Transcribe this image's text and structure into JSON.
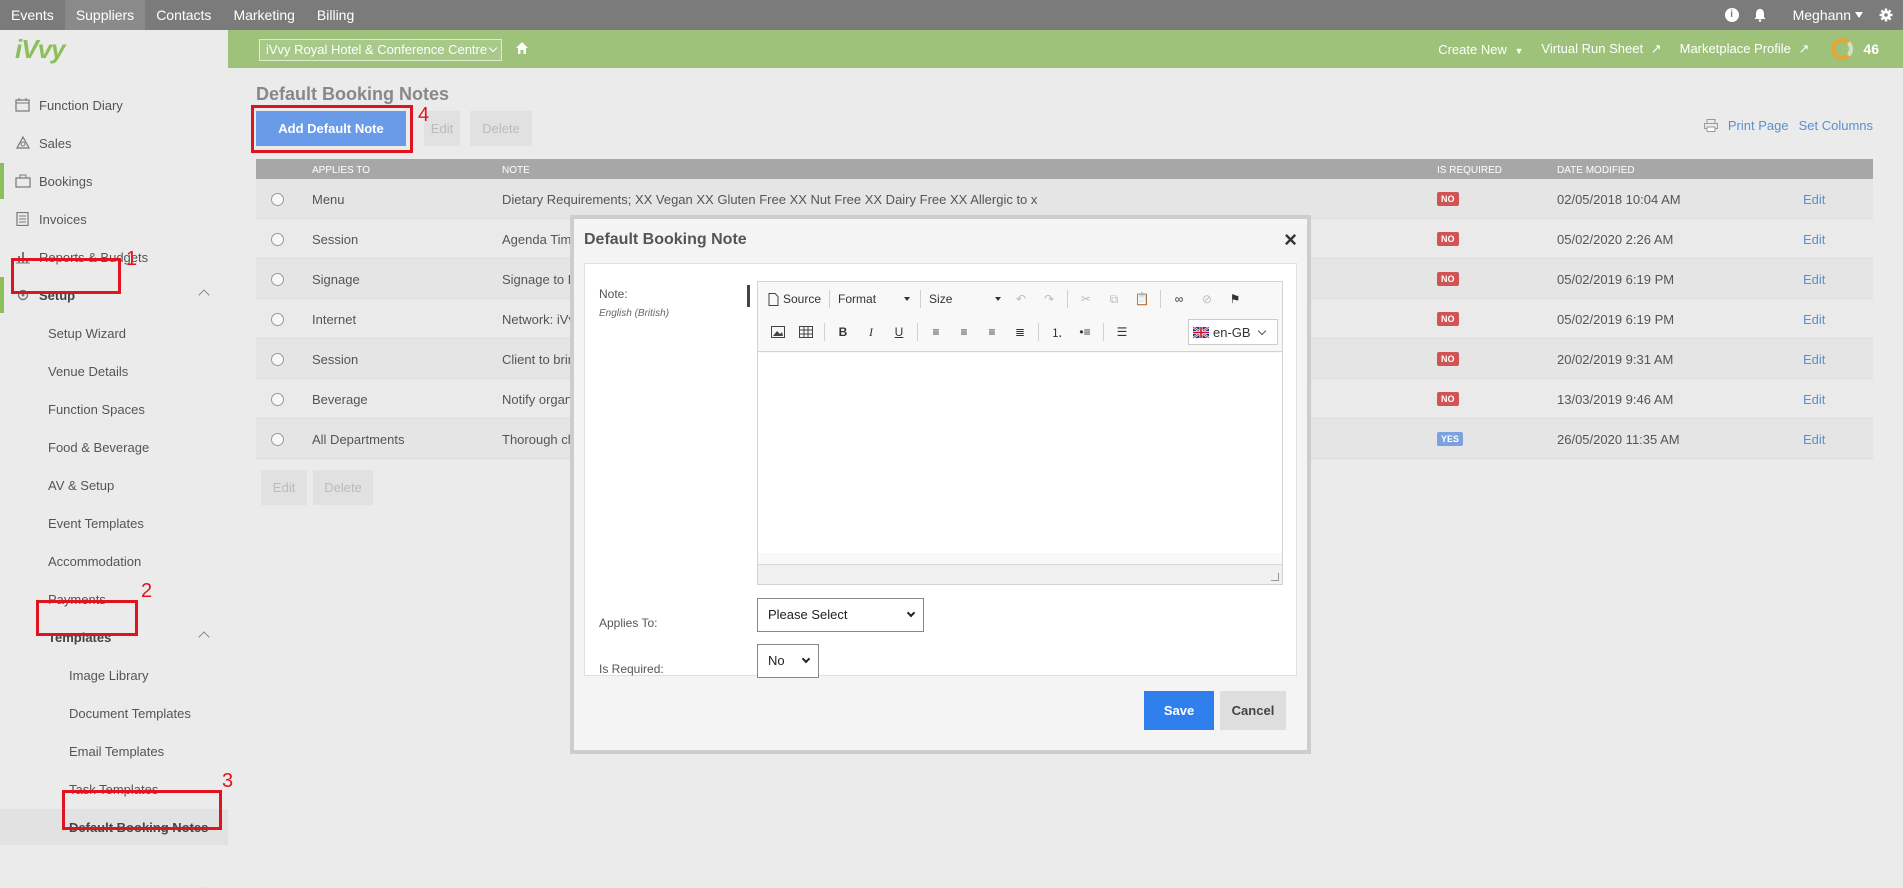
{
  "topnav": {
    "items": [
      "Events",
      "Suppliers",
      "Contacts",
      "Marketing",
      "Billing"
    ],
    "active": "Suppliers",
    "user": "Meghann"
  },
  "logo": "iVvy",
  "sidebar": {
    "items": [
      {
        "label": "Function Diary",
        "icon": "calendar-icon"
      },
      {
        "label": "Sales",
        "icon": "sales-icon"
      },
      {
        "label": "Bookings",
        "icon": "briefcase-icon"
      },
      {
        "label": "Invoices",
        "icon": "calculator-icon"
      },
      {
        "label": "Reports & Budgets",
        "icon": "bar-chart-icon"
      },
      {
        "label": "Setup",
        "icon": "gear-icon"
      }
    ],
    "setup_items": [
      "Setup Wizard",
      "Venue Details",
      "Function Spaces",
      "Food & Beverage",
      "AV & Setup",
      "Event Templates",
      "Accommodation",
      "Payments",
      "Templates"
    ],
    "template_items": [
      "Image Library",
      "Document Templates",
      "Email Templates",
      "Task Templates",
      "Default Booking Notes"
    ],
    "collapse": "«"
  },
  "greenbar": {
    "venue": "iVvy Royal Hotel & Conference Centre",
    "create_new": "Create New",
    "virtual_run_sheet": "Virtual Run Sheet",
    "marketplace_profile": "Marketplace Profile",
    "score": "46"
  },
  "page": {
    "title": "Default Booking Notes",
    "add_button": "Add Default Note",
    "edit_button": "Edit",
    "delete_button": "Delete",
    "print_page": "Print Page",
    "set_columns": "Set Columns"
  },
  "table": {
    "headers": [
      "Applies To",
      "Note",
      "Is Required",
      "Date Modified"
    ],
    "rows": [
      {
        "applies_to": "Menu",
        "note": "Dietary Requirements;  XX Vegan XX Gluten Free XX Nut Free XX Dairy Free XX Allergic to x",
        "required": "NO",
        "date": "02/05/2018 10:04 AM",
        "action": "Edit"
      },
      {
        "applies_to": "Session",
        "note": "Agenda Time",
        "required": "NO",
        "date": "05/02/2020 2:26 AM",
        "action": "Edit"
      },
      {
        "applies_to": "Signage",
        "note": "Signage to R",
        "required": "NO",
        "date": "05/02/2019 6:19 PM",
        "action": "Edit"
      },
      {
        "applies_to": "Internet",
        "note": "Network: iVv",
        "required": "NO",
        "date": "05/02/2019 6:19 PM",
        "action": "Edit"
      },
      {
        "applies_to": "Session",
        "note": "Client to brin",
        "required": "NO",
        "date": "20/02/2019 9:31 AM",
        "action": "Edit"
      },
      {
        "applies_to": "Beverage",
        "note": "Notify organ",
        "required": "NO",
        "date": "13/03/2019 9:46 AM",
        "action": "Edit"
      },
      {
        "applies_to": "All Departments",
        "note": "Thorough cle",
        "required": "YES",
        "date": "26/05/2020 11:35 AM",
        "action": "Edit"
      }
    ]
  },
  "annotations": [
    "1",
    "2",
    "3",
    "4"
  ],
  "modal": {
    "title": "Default Booking Note",
    "close": "×",
    "note_label": "Note:",
    "note_lang": "English (British)",
    "toolbar": {
      "source": "Source",
      "format": "Format",
      "size": "Size",
      "bold": "B",
      "italic": "I",
      "underline": "U",
      "lang": "en-GB"
    },
    "applies_to_label": "Applies To:",
    "applies_to_value": "Please Select",
    "is_required_label": "Is Required:",
    "is_required_value": "No",
    "save": "Save",
    "cancel": "Cancel"
  }
}
